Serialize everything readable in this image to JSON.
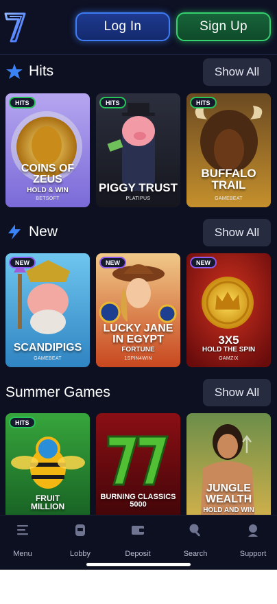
{
  "header": {
    "logo_icon": "seven-logo-icon",
    "login_label": "Log In",
    "signup_label": "Sign Up",
    "colors": {
      "login": "#3f7df5",
      "signup": "#36d26f",
      "background": "#0d1021"
    }
  },
  "sections": [
    {
      "title": "Hits",
      "icon": "star-icon",
      "show_all_label": "Show All",
      "games": [
        {
          "badge": "HITS",
          "title": "COINS OF ZEUS",
          "subtitle": "HOLD & WIN",
          "provider": "BETSOFT"
        },
        {
          "badge": "HITS",
          "title": "PIGGY TRUST",
          "subtitle": "",
          "provider": "PLATIPUS"
        },
        {
          "badge": "HITS",
          "title": "BUFFALO TRAIL",
          "subtitle": "",
          "provider": "GAMEBEAT"
        }
      ]
    },
    {
      "title": "New",
      "icon": "lightning-icon",
      "show_all_label": "Show All",
      "games": [
        {
          "badge": "NEW",
          "title": "SCANDIPIGS",
          "subtitle": "",
          "provider": "GAMEBEAT"
        },
        {
          "badge": "NEW",
          "title": "LUCKY JANE IN EGYPT",
          "subtitle": "FORTUNE",
          "provider": "1SPIN4WIN"
        },
        {
          "badge": "NEW",
          "title": "3X5",
          "subtitle": "HOLD THE SPIN",
          "provider": "GAMZIX"
        }
      ]
    },
    {
      "title": "Summer Games",
      "icon": "",
      "show_all_label": "Show All",
      "games": [
        {
          "badge": "HITS",
          "title": "FRUIT MILLION",
          "subtitle": "",
          "provider": ""
        },
        {
          "badge": "",
          "title": "BURNING CLASSICS 5000",
          "subtitle": "",
          "provider": ""
        },
        {
          "badge": "",
          "title": "JUNGLE WEALTH",
          "subtitle": "HOLD AND WIN",
          "provider": ""
        }
      ]
    }
  ],
  "nav": [
    {
      "label": "Menu",
      "icon": "menu-icon"
    },
    {
      "label": "Lobby",
      "icon": "slot-machine-icon"
    },
    {
      "label": "Deposit",
      "icon": "wallet-icon"
    },
    {
      "label": "Search",
      "icon": "search-icon"
    },
    {
      "label": "Support",
      "icon": "support-agent-icon"
    }
  ]
}
